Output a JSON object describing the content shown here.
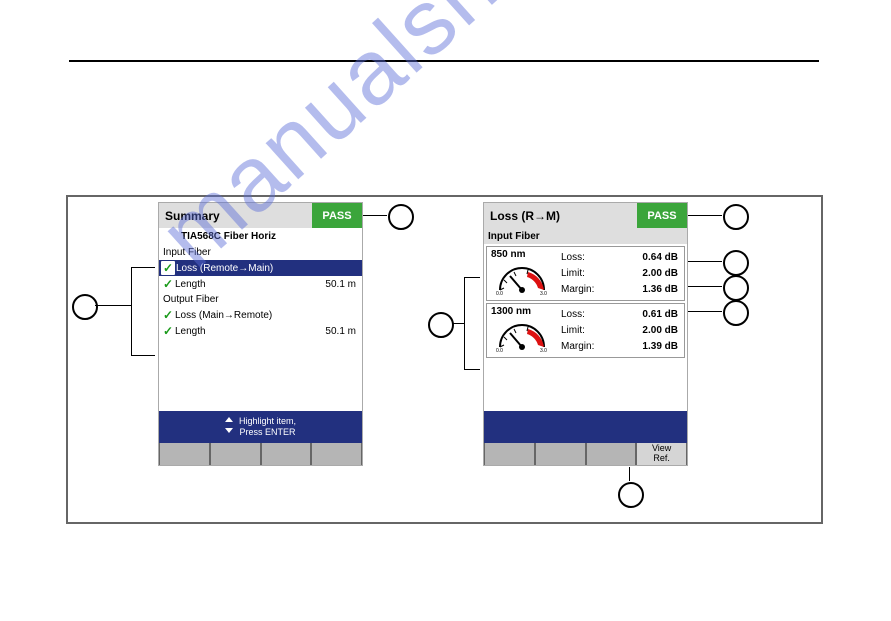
{
  "watermark": "manualshive.com",
  "left_panel": {
    "title": "Summary",
    "pass": "PASS",
    "test_standard": "TIA568C Fiber Horiz",
    "input_label": "Input Fiber",
    "output_label": "Output Fiber",
    "rows": {
      "loss_rm": "Loss (Remote→Main)",
      "len1_label": "Length",
      "len1_val": "50.1 m",
      "loss_mr": "Loss (Main→Remote)",
      "len2_label": "Length",
      "len2_val": "50.1 m"
    },
    "hint_line1": "Highlight item,",
    "hint_line2": "Press ENTER"
  },
  "right_panel": {
    "title": "Loss (R→M)",
    "pass": "PASS",
    "section": "Input Fiber",
    "g850": {
      "wl": "850 nm",
      "loss_l": "Loss:",
      "loss_v": "0.64 dB",
      "limit_l": "Limit:",
      "limit_v": "2.00 dB",
      "margin_l": "Margin:",
      "margin_v": "1.36 dB",
      "scale_lo": "0.0",
      "scale_hi": "3.0"
    },
    "g1300": {
      "wl": "1300 nm",
      "loss_l": "Loss:",
      "loss_v": "0.61 dB",
      "limit_l": "Limit:",
      "limit_v": "2.00 dB",
      "margin_l": "Margin:",
      "margin_v": "1.39 dB",
      "scale_lo": "0.0",
      "scale_hi": "3.0"
    },
    "soft_view": "View\nRef."
  }
}
